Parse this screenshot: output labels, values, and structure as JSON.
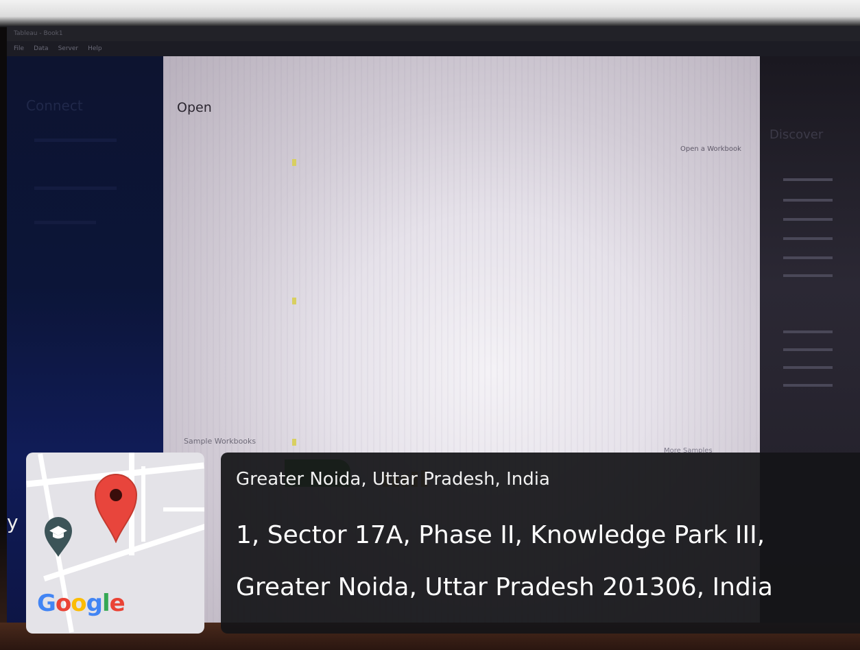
{
  "app": {
    "title_bar": "Tableau - Book1",
    "menu": [
      "File",
      "Data",
      "Server",
      "Help"
    ]
  },
  "connect": {
    "title": "Connect"
  },
  "main": {
    "open_title": "Open",
    "open_workbook_link": "Open a Workbook",
    "sample_workbooks": "Sample Workbooks",
    "more_samples": "More Samples"
  },
  "discover": {
    "title": "Discover"
  },
  "geotag": {
    "short_location": "Greater Noida, Uttar Pradesh, India",
    "address_line_1": "1, Sector 17A, Phase II, Knowledge Park III,",
    "address_line_2": "Greater Noida, Uttar Pradesh 201306, India",
    "map_logo": "Google",
    "pin_icon": "map-pin-icon",
    "place_icon": "graduation-cap-icon",
    "edge_fragment": "y",
    "colors": {
      "pin": "#e8453c",
      "place_marker": "#3c5458",
      "panel": "#141418"
    }
  }
}
